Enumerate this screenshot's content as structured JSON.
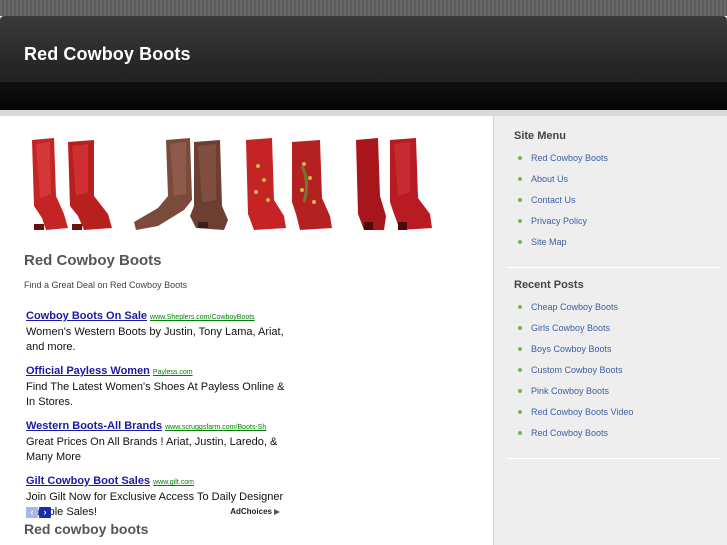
{
  "header": {
    "site_title": "Red Cowboy Boots",
    "tagline": "Red Cowboy Boots"
  },
  "main": {
    "product_images": [
      {
        "icon": "red-cowboy-boots-image"
      },
      {
        "icon": "brown-cowboy-boots-image"
      },
      {
        "icon": "red-studded-cowboy-boots-image"
      },
      {
        "icon": "dark-red-cowboy-boots-image"
      }
    ],
    "post_title": "Red Cowboy Boots",
    "intro": "Find a Great Deal on Red Cowboy Boots",
    "ads": [
      {
        "title": "Cowboy Boots On Sale",
        "url": "www.Sheplers.com/CowboyBoots",
        "text": "Women's Western Boots by Justin, Tony Lama, Ariat, and more."
      },
      {
        "title": "Official Payless Women",
        "url": "Payless.com",
        "text": "Find The Latest Women's Shoes At Payless Online & In Stores."
      },
      {
        "title": "Western Boots-All Brands",
        "url": "www.scruggsfarm.com/Boots-Sh",
        "text": "Great Prices On All Brands ! Ariat, Justin, Laredo, & Many More"
      },
      {
        "title": "Gilt Cowboy Boot Sales",
        "url": "www.gilt.com",
        "text": "Join Gilt Now for Exclusive Access To Daily Designer Sample Sales!"
      }
    ],
    "ad_nav": {
      "prev": "‹",
      "next": "›",
      "adchoices": "AdChoices"
    },
    "sub_heading": "Red cowboy boots"
  },
  "sidebar": {
    "site_menu_title": "Site Menu",
    "site_menu": [
      "Red Cowboy Boots",
      "About Us",
      "Contact Us",
      "Privacy Policy",
      "Site Map"
    ],
    "recent_posts_title": "Recent Posts",
    "recent_posts": [
      "Cheap Cowboy Boots",
      "Girls Cowboy Boots",
      "Boys Cowboy Boots",
      "Custom Cowboy Boots",
      "Pink Cowboy Boots",
      "Red Cowboy Boots Video",
      "Red Cowboy Boots"
    ]
  },
  "colors": {
    "header_bg": "#262626",
    "link": "#3b5fa3",
    "ad_title": "#1a1aa6",
    "ad_url": "#008000",
    "bullet": "#7db14e",
    "boot_red": "#c42424",
    "boot_brown": "#7a4a3a"
  }
}
